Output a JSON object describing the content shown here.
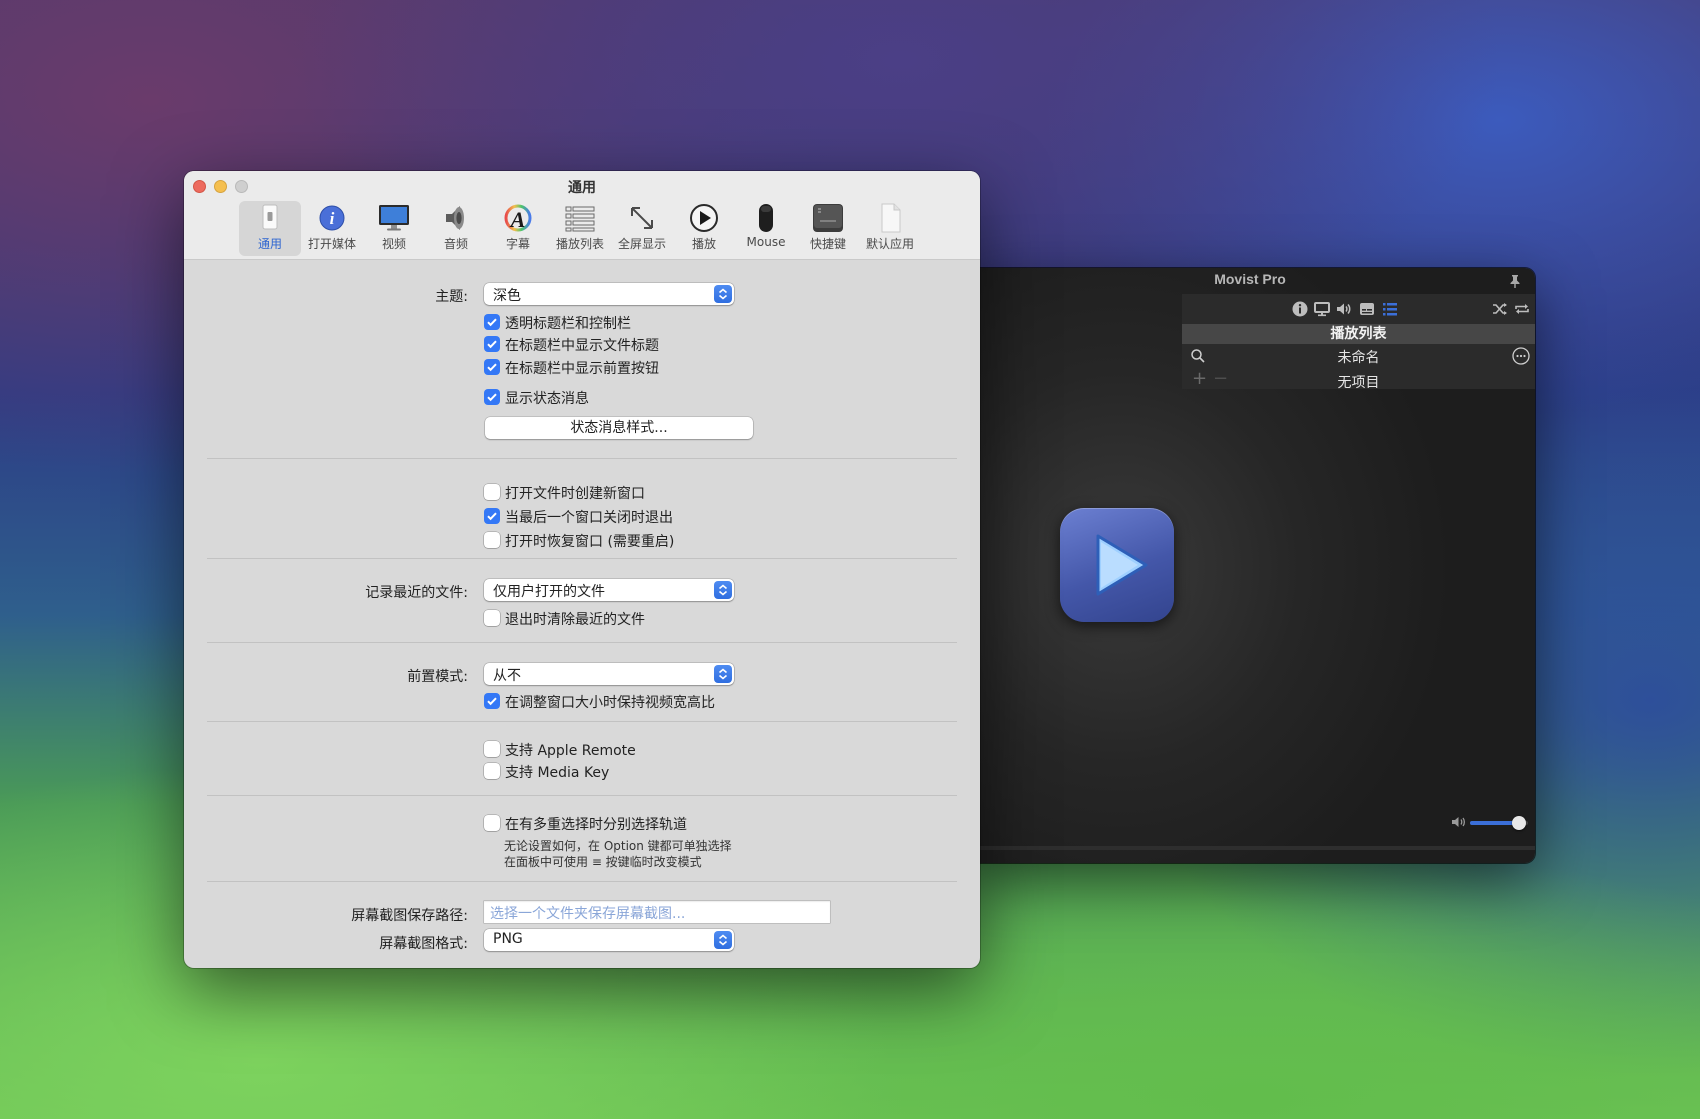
{
  "player": {
    "title": "Movist Pro",
    "playlist": {
      "header": "播放列表",
      "name": "未命名",
      "empty_text": "无项目",
      "add_symbol": "+",
      "remove_symbol": "−"
    },
    "volume_level": 0.85,
    "accent_color": "#3b6fd8"
  },
  "settings": {
    "title": "通用",
    "toolbar": [
      {
        "label": "通用",
        "icon": "general-switch-icon",
        "selected": true
      },
      {
        "label": "打开媒体",
        "icon": "info-icon"
      },
      {
        "label": "视频",
        "icon": "monitor-icon"
      },
      {
        "label": "音频",
        "icon": "speaker-icon"
      },
      {
        "label": "字幕",
        "icon": "subtitle-font-icon"
      },
      {
        "label": "播放列表",
        "icon": "playlist-icon"
      },
      {
        "label": "全屏显示",
        "icon": "fullscreen-arrows-icon"
      },
      {
        "label": "播放",
        "icon": "play-circle-icon"
      },
      {
        "label": "Mouse",
        "icon": "mouse-icon"
      },
      {
        "label": "快捷键",
        "icon": "option-key-icon"
      },
      {
        "label": "默认应用",
        "icon": "document-icon"
      }
    ],
    "theme": {
      "label": "主题:",
      "value": "深色"
    },
    "appearance_options": [
      {
        "label": "透明标题栏和控制栏",
        "checked": true
      },
      {
        "label": "在标题栏中显示文件标题",
        "checked": true
      },
      {
        "label": "在标题栏中显示前置按钮",
        "checked": true
      },
      {
        "label": "显示状态消息",
        "checked": true
      }
    ],
    "status_style_button": "状态消息样式...",
    "window_options": [
      {
        "label": "打开文件时创建新窗口",
        "checked": false
      },
      {
        "label": "当最后一个窗口关闭时退出",
        "checked": true
      },
      {
        "label": "打开时恢复窗口 (需要重启)",
        "checked": false
      }
    ],
    "recent_files": {
      "label": "记录最近的文件:",
      "value": "仅用户打开的文件"
    },
    "clear_recent": {
      "label": "退出时清除最近的文件",
      "checked": false
    },
    "front_mode": {
      "label": "前置模式:",
      "value": "从不"
    },
    "keep_aspect": {
      "label": "在调整窗口大小时保持视频宽高比",
      "checked": true
    },
    "remote_options": [
      {
        "label": "支持 Apple Remote",
        "checked": false
      },
      {
        "label": "支持 Media Key",
        "checked": false
      }
    ],
    "track_select": {
      "label": "在有多重选择时分别选择轨道",
      "checked": false
    },
    "track_note_1": "无论设置如何，在 Option 键都可单独选择",
    "track_note_2": "在面板中可使用 ≡ 按键临时改变模式",
    "screenshot_path": {
      "label": "屏幕截图保存路径:",
      "placeholder": "选择一个文件夹保存屏幕截图..."
    },
    "screenshot_format": {
      "label": "屏幕截图格式:",
      "value": "PNG"
    },
    "check_color": "#3478f6"
  }
}
